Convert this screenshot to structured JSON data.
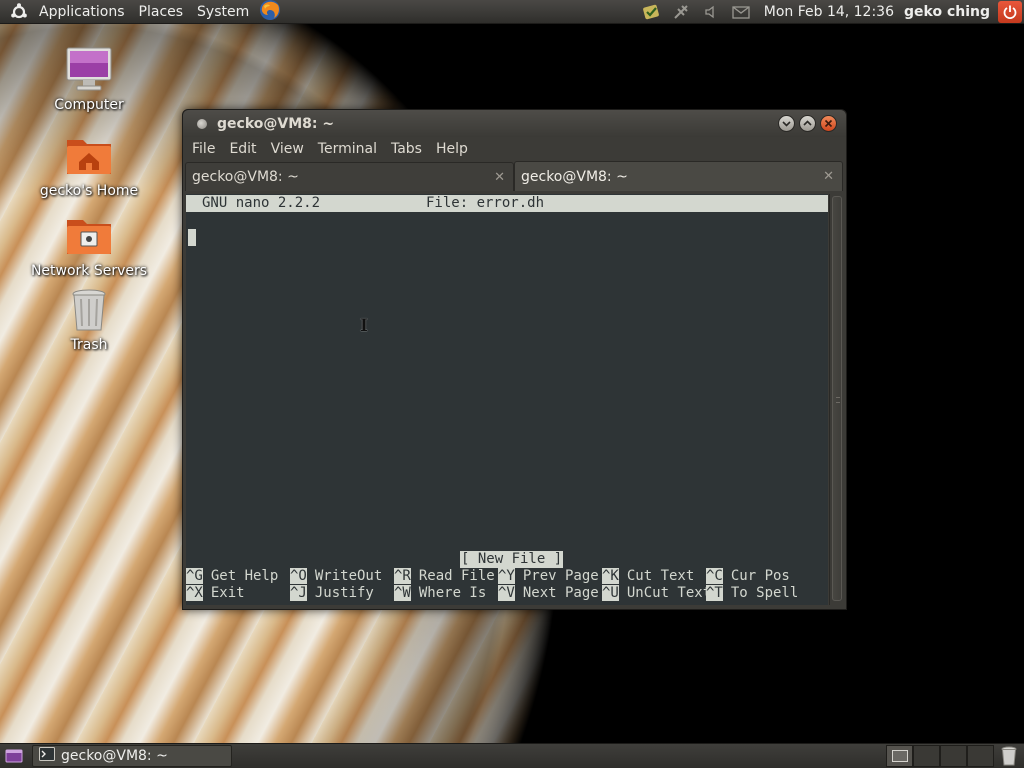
{
  "top_panel": {
    "menus": [
      "Applications",
      "Places",
      "System"
    ],
    "clock": "Mon Feb 14, 12:36",
    "username": "geko ching"
  },
  "desktop": {
    "icons": [
      {
        "label": "Computer",
        "icon": "computer-icon"
      },
      {
        "label": "gecko's Home",
        "icon": "home-folder-icon"
      },
      {
        "label": "Network Servers",
        "icon": "network-folder-icon"
      },
      {
        "label": "Trash",
        "icon": "trash-icon"
      }
    ]
  },
  "window": {
    "title": "gecko@VM8: ~",
    "menu": [
      "File",
      "Edit",
      "View",
      "Terminal",
      "Tabs",
      "Help"
    ],
    "tabs": [
      {
        "label": "gecko@VM8: ~",
        "active": false
      },
      {
        "label": "gecko@VM8: ~",
        "active": true
      }
    ]
  },
  "nano": {
    "version": "GNU nano 2.2.2",
    "file": "File: error.dh",
    "status": "[ New File ]",
    "shortcuts_row1": [
      {
        "key": "^G",
        "desc": "Get Help"
      },
      {
        "key": "^O",
        "desc": "WriteOut"
      },
      {
        "key": "^R",
        "desc": "Read File"
      },
      {
        "key": "^Y",
        "desc": "Prev Page"
      },
      {
        "key": "^K",
        "desc": "Cut Text"
      },
      {
        "key": "^C",
        "desc": "Cur Pos"
      }
    ],
    "shortcuts_row2": [
      {
        "key": "^X",
        "desc": "Exit"
      },
      {
        "key": "^J",
        "desc": "Justify"
      },
      {
        "key": "^W",
        "desc": "Where Is"
      },
      {
        "key": "^V",
        "desc": "Next Page"
      },
      {
        "key": "^U",
        "desc": "UnCut Text"
      },
      {
        "key": "^T",
        "desc": "To Spell"
      }
    ]
  },
  "bottom_panel": {
    "task_label": "gecko@VM8: ~"
  },
  "colors": {
    "terminal_bg": "#2e3436",
    "terminal_fg": "#d3d7cf",
    "panel_bg": "#3a3936",
    "power_accent": "#d1471e"
  }
}
